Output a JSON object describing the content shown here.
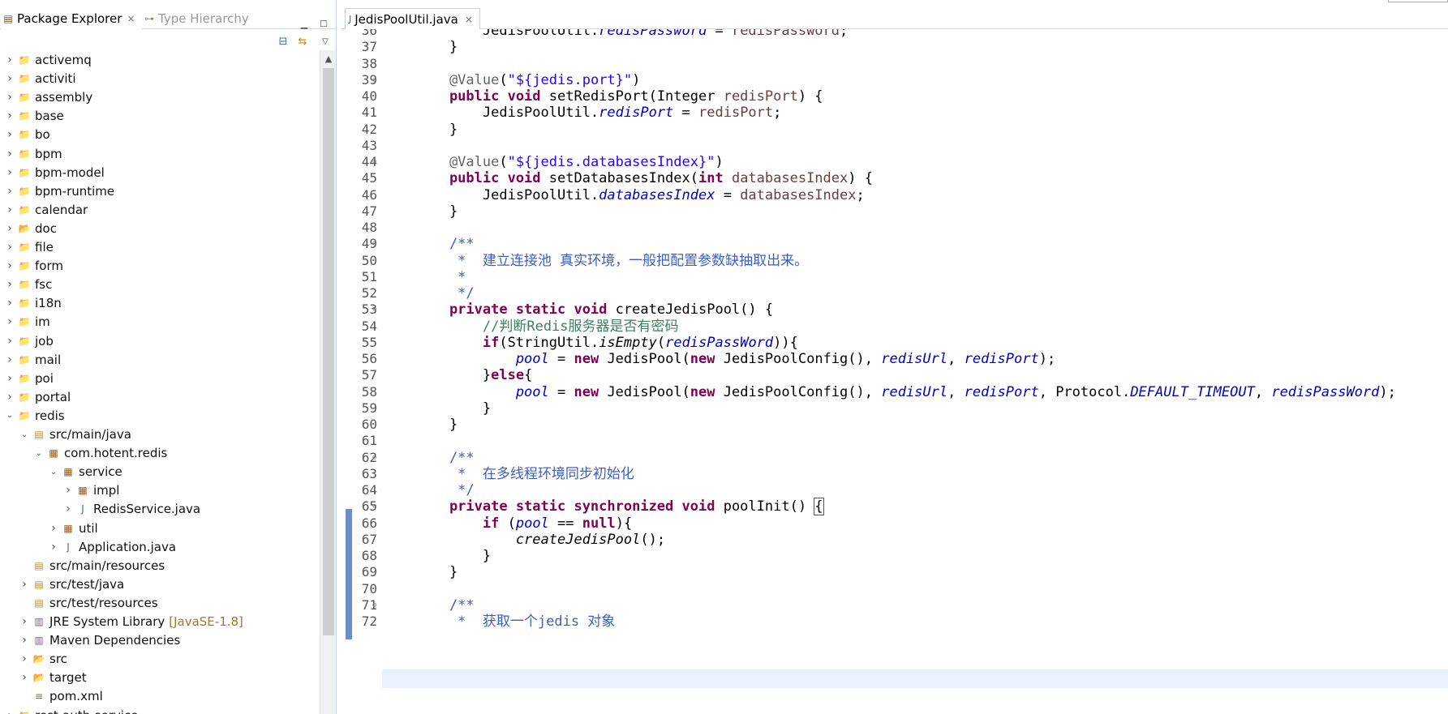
{
  "left_panel": {
    "tabs": [
      {
        "label": "Package Explorer",
        "active": true
      },
      {
        "label": "Type Hierarchy",
        "active": false
      }
    ],
    "close_symbol": "×"
  },
  "tree": [
    {
      "label": "activemq",
      "indent": 0,
      "toggle": "collapsed",
      "icon": "project"
    },
    {
      "label": "activiti",
      "indent": 0,
      "toggle": "collapsed",
      "icon": "project"
    },
    {
      "label": "assembly",
      "indent": 0,
      "toggle": "collapsed",
      "icon": "project"
    },
    {
      "label": "base",
      "indent": 0,
      "toggle": "collapsed",
      "icon": "project"
    },
    {
      "label": "bo",
      "indent": 0,
      "toggle": "collapsed",
      "icon": "project"
    },
    {
      "label": "bpm",
      "indent": 0,
      "toggle": "collapsed",
      "icon": "project"
    },
    {
      "label": "bpm-model",
      "indent": 0,
      "toggle": "collapsed",
      "icon": "project"
    },
    {
      "label": "bpm-runtime",
      "indent": 0,
      "toggle": "collapsed",
      "icon": "project"
    },
    {
      "label": "calendar",
      "indent": 0,
      "toggle": "collapsed",
      "icon": "project"
    },
    {
      "label": "doc",
      "indent": 0,
      "toggle": "collapsed",
      "icon": "folder"
    },
    {
      "label": "file",
      "indent": 0,
      "toggle": "collapsed",
      "icon": "project"
    },
    {
      "label": "form",
      "indent": 0,
      "toggle": "collapsed",
      "icon": "project"
    },
    {
      "label": "fsc",
      "indent": 0,
      "toggle": "collapsed",
      "icon": "project"
    },
    {
      "label": "i18n",
      "indent": 0,
      "toggle": "collapsed",
      "icon": "project"
    },
    {
      "label": "im",
      "indent": 0,
      "toggle": "collapsed",
      "icon": "project"
    },
    {
      "label": "job",
      "indent": 0,
      "toggle": "collapsed",
      "icon": "project"
    },
    {
      "label": "mail",
      "indent": 0,
      "toggle": "collapsed",
      "icon": "project"
    },
    {
      "label": "poi",
      "indent": 0,
      "toggle": "collapsed",
      "icon": "project"
    },
    {
      "label": "portal",
      "indent": 0,
      "toggle": "collapsed",
      "icon": "project"
    },
    {
      "label": "redis",
      "indent": 0,
      "toggle": "expanded",
      "icon": "project"
    },
    {
      "label": "src/main/java",
      "indent": 1,
      "toggle": "expanded",
      "icon": "srcfolder"
    },
    {
      "label": "com.hotent.redis",
      "indent": 2,
      "toggle": "expanded",
      "icon": "package"
    },
    {
      "label": "service",
      "indent": 3,
      "toggle": "expanded",
      "icon": "package"
    },
    {
      "label": "impl",
      "indent": 4,
      "toggle": "collapsed",
      "icon": "package"
    },
    {
      "label": "RedisService.java",
      "indent": 4,
      "toggle": "collapsed",
      "icon": "java"
    },
    {
      "label": "util",
      "indent": 3,
      "toggle": "collapsed",
      "icon": "package"
    },
    {
      "label": "Application.java",
      "indent": 3,
      "toggle": "collapsed",
      "icon": "java"
    },
    {
      "label": "src/main/resources",
      "indent": 1,
      "toggle": "none",
      "icon": "srcfolder"
    },
    {
      "label": "src/test/java",
      "indent": 1,
      "toggle": "collapsed",
      "icon": "srcfolder"
    },
    {
      "label": "src/test/resources",
      "indent": 1,
      "toggle": "none",
      "icon": "srcfolder"
    },
    {
      "label": "JRE System Library",
      "decoration": "[JavaSE-1.8]",
      "indent": 1,
      "toggle": "collapsed",
      "icon": "library"
    },
    {
      "label": "Maven Dependencies",
      "indent": 1,
      "toggle": "collapsed",
      "icon": "library"
    },
    {
      "label": "src",
      "indent": 1,
      "toggle": "collapsed",
      "icon": "folder"
    },
    {
      "label": "target",
      "indent": 1,
      "toggle": "collapsed",
      "icon": "folder"
    },
    {
      "label": "pom.xml",
      "indent": 1,
      "toggle": "none",
      "icon": "xml"
    },
    {
      "label": "rest-auth-service",
      "indent": 0,
      "toggle": "collapsed",
      "icon": "project"
    }
  ],
  "editor": {
    "tab_label": "JedisPoolUtil.java",
    "lines": [
      {
        "n": "36",
        "segs": [
          [
            "",
            "        JedisPoolUtil."
          ],
          [
            "fldi",
            "redisPassword"
          ],
          [
            "",
            " = "
          ],
          [
            "var",
            "redisPassword"
          ],
          [
            "",
            ";"
          ]
        ]
      },
      {
        "n": "37",
        "segs": [
          [
            "",
            "    }"
          ]
        ]
      },
      {
        "n": "38",
        "segs": []
      },
      {
        "n": "39",
        "fold": true,
        "segs": [
          [
            "ann",
            "    @Value"
          ],
          [
            "",
            "("
          ],
          [
            "str",
            "\"${jedis.port}\""
          ],
          [
            "",
            ")"
          ]
        ]
      },
      {
        "n": "40",
        "segs": [
          [
            "kw",
            "    public void "
          ],
          [
            "",
            "setRedisPort(Integer "
          ],
          [
            "var",
            "redisPort"
          ],
          [
            "",
            ") {"
          ]
        ]
      },
      {
        "n": "41",
        "segs": [
          [
            "",
            "        JedisPoolUtil."
          ],
          [
            "fldi",
            "redisPort"
          ],
          [
            "",
            " = "
          ],
          [
            "var",
            "redisPort"
          ],
          [
            "",
            ";"
          ]
        ]
      },
      {
        "n": "42",
        "segs": [
          [
            "",
            "    }"
          ]
        ]
      },
      {
        "n": "43",
        "segs": []
      },
      {
        "n": "44",
        "fold": true,
        "segs": [
          [
            "ann",
            "    @Value"
          ],
          [
            "",
            "("
          ],
          [
            "str",
            "\"${jedis.databasesIndex}\""
          ],
          [
            "",
            ")"
          ]
        ]
      },
      {
        "n": "45",
        "segs": [
          [
            "kw",
            "    public void "
          ],
          [
            "",
            "setDatabasesIndex("
          ],
          [
            "kw",
            "int "
          ],
          [
            "var",
            "databasesIndex"
          ],
          [
            "",
            ") {"
          ]
        ]
      },
      {
        "n": "46",
        "segs": [
          [
            "",
            "        JedisPoolUtil."
          ],
          [
            "fldi",
            "databasesIndex"
          ],
          [
            "",
            " = "
          ],
          [
            "var",
            "databasesIndex"
          ],
          [
            "",
            ";"
          ]
        ]
      },
      {
        "n": "47",
        "segs": [
          [
            "",
            "    }"
          ]
        ]
      },
      {
        "n": "48",
        "segs": []
      },
      {
        "n": "49",
        "fold": true,
        "segs": [
          [
            "cmt",
            "    /**"
          ]
        ]
      },
      {
        "n": "50",
        "segs": [
          [
            "cmt",
            "     *  建立连接池 真实环境，一般把配置参数缺抽取出来。"
          ]
        ]
      },
      {
        "n": "51",
        "segs": [
          [
            "cmt",
            "     *"
          ]
        ]
      },
      {
        "n": "52",
        "segs": [
          [
            "cmt",
            "     */"
          ]
        ]
      },
      {
        "n": "53",
        "fold": true,
        "segs": [
          [
            "kw",
            "    private static void "
          ],
          [
            "",
            "createJedisPool() {"
          ]
        ]
      },
      {
        "n": "54",
        "segs": [
          [
            "lcmt",
            "        //判断Redis服务器是否有密码"
          ]
        ]
      },
      {
        "n": "55",
        "segs": [
          [
            "kw",
            "        if"
          ],
          [
            "",
            "(StringUtil."
          ],
          [
            "mi",
            "isEmpty"
          ],
          [
            "",
            "("
          ],
          [
            "fldi",
            "redisPassWord"
          ],
          [
            "",
            ")){"
          ]
        ]
      },
      {
        "n": "56",
        "segs": [
          [
            "fldi",
            "            pool"
          ],
          [
            "",
            " = "
          ],
          [
            "kw",
            "new "
          ],
          [
            "",
            "JedisPool("
          ],
          [
            "kw",
            "new "
          ],
          [
            "",
            "JedisPoolConfig(), "
          ],
          [
            "fldi",
            "redisUrl"
          ],
          [
            "",
            ", "
          ],
          [
            "fldi",
            "redisPort"
          ],
          [
            "",
            ");"
          ]
        ]
      },
      {
        "n": "57",
        "segs": [
          [
            "",
            "        }"
          ],
          [
            "kw",
            "else"
          ],
          [
            "",
            "{"
          ]
        ]
      },
      {
        "n": "58",
        "segs": [
          [
            "fldi",
            "            pool"
          ],
          [
            "",
            " = "
          ],
          [
            "kw",
            "new "
          ],
          [
            "",
            "JedisPool("
          ],
          [
            "kw",
            "new "
          ],
          [
            "",
            "JedisPoolConfig(), "
          ],
          [
            "fldi",
            "redisUrl"
          ],
          [
            "",
            ", "
          ],
          [
            "fldi",
            "redisPort"
          ],
          [
            "",
            ", Protocol."
          ],
          [
            "fldi",
            "DEFAULT_TIMEOUT"
          ],
          [
            "",
            ", "
          ],
          [
            "fldi",
            "redisPassWord"
          ],
          [
            "",
            ");"
          ]
        ]
      },
      {
        "n": "59",
        "segs": [
          [
            "",
            "        }"
          ]
        ]
      },
      {
        "n": "60",
        "segs": [
          [
            "",
            "    }"
          ]
        ]
      },
      {
        "n": "61",
        "segs": []
      },
      {
        "n": "62",
        "fold": true,
        "segs": [
          [
            "cmt",
            "    /**"
          ]
        ]
      },
      {
        "n": "63",
        "segs": [
          [
            "cmt",
            "     *  在多线程环境同步初始化"
          ]
        ]
      },
      {
        "n": "64",
        "segs": [
          [
            "cmt",
            "     */"
          ]
        ]
      },
      {
        "n": "65",
        "fold": true,
        "segs": [
          [
            "kw",
            "    private static synchronized void "
          ],
          [
            "",
            "poolInit() "
          ],
          [
            "brk",
            "{"
          ]
        ]
      },
      {
        "n": "66",
        "segs": [
          [
            "kw",
            "        if "
          ],
          [
            "",
            "("
          ],
          [
            "fldi",
            "pool"
          ],
          [
            "",
            " == "
          ],
          [
            "kw",
            "null"
          ],
          [
            "",
            "){"
          ]
        ]
      },
      {
        "n": "67",
        "segs": [
          [
            "mi",
            "            createJedisPool"
          ],
          [
            "",
            "();"
          ]
        ]
      },
      {
        "n": "68",
        "segs": [
          [
            "",
            "        }"
          ]
        ]
      },
      {
        "n": "69",
        "segs": [
          [
            "",
            "    }"
          ]
        ]
      },
      {
        "n": "70",
        "segs": []
      },
      {
        "n": "71",
        "fold": true,
        "segs": [
          [
            "cmt",
            "    /**"
          ]
        ]
      },
      {
        "n": "72",
        "segs": [
          [
            "cmt",
            "     *  获取一个jedis 对象"
          ]
        ]
      }
    ]
  },
  "icons": {
    "project": "📁",
    "folder": "📂",
    "srcfolder": "▤",
    "package": "▦",
    "java": "J",
    "library": "▥",
    "xml": "≡"
  },
  "colors": {
    "keyword": "#7f0055",
    "string": "#2a00ff",
    "field": "#0000c0",
    "javadoc": "#3f5fbf",
    "line_comment": "#3f7f5f",
    "current_line": "#e8f2fe"
  }
}
